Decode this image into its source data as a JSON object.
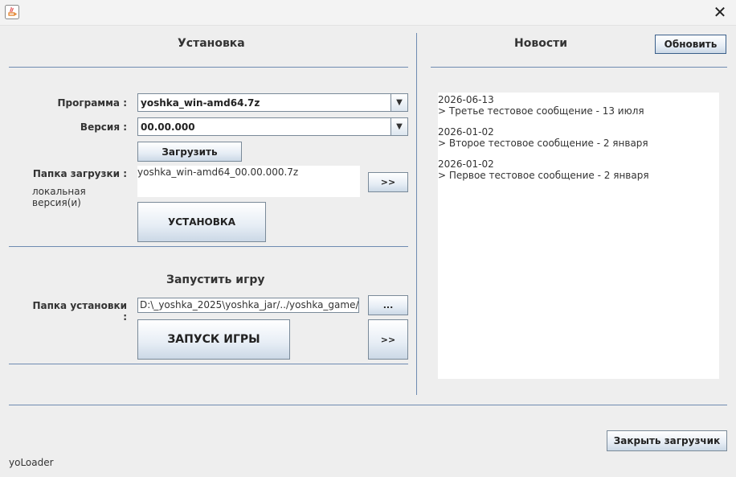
{
  "window": {
    "close_glyph": "✕"
  },
  "install": {
    "title": "Установка",
    "program_label": "Программа :",
    "program_value": "yoshka_win-amd64.7z",
    "version_label": "Версия :",
    "version_value": "00.00.000",
    "download_button": "Загрузить",
    "download_folder_label": "Папка загрузки :",
    "local_version_label": "локальная версия(и)",
    "download_file": "yoshka_win-amd64_00.00.000.7z",
    "open_button": ">>",
    "install_button": "УСТАНОВКА"
  },
  "launch": {
    "title": "Запустить игру",
    "install_folder_label": "Папка установки :",
    "install_folder_value": "D:\\_yoshka_2025\\yoshka_jar/../yoshka_game/",
    "browse_button": "...",
    "launch_button": "ЗАПУСК ИГРЫ",
    "open_button": ">>"
  },
  "news": {
    "title": "Новости",
    "refresh_button": "Обновить",
    "items": [
      {
        "date": "2026-06-13",
        "text": " > Третье тестовое сообщение - 13 июля"
      },
      {
        "date": " 2026-01-02",
        "text": " > Второе тестовое сообщение  - 2 января"
      },
      {
        "date": " 2026-01-02",
        "text": " > Первое тестовое сообщение - 2 января"
      }
    ]
  },
  "footer": {
    "close_loader_button": "Закрыть загрузчик",
    "app_name": "yoLoader"
  },
  "colors": {
    "separator": "#6f8bb1",
    "background": "#eeeeee"
  }
}
